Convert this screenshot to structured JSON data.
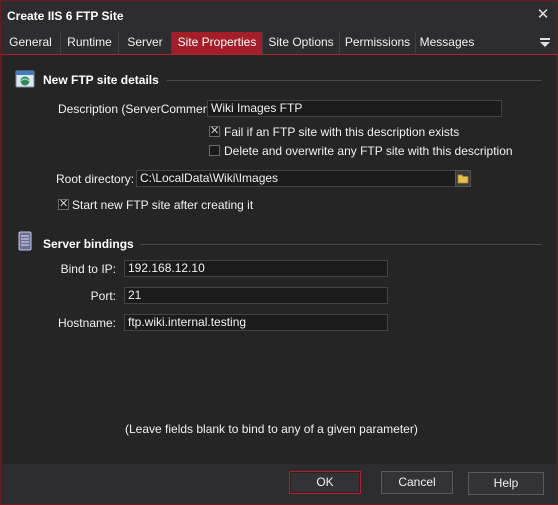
{
  "window": {
    "title": "Create IIS 6 FTP Site"
  },
  "tabs": [
    {
      "label": "General"
    },
    {
      "label": "Runtime"
    },
    {
      "label": "Server"
    },
    {
      "label": "Site Properties"
    },
    {
      "label": "Site Options"
    },
    {
      "label": "Permissions"
    },
    {
      "label": "Messages"
    }
  ],
  "active_tab": "Site Properties",
  "colors": {
    "accent": "#a31e28",
    "background": "#252526",
    "chrome": "#2d2d30"
  },
  "new_site": {
    "section_title": "New FTP site details",
    "description_label": "Description (ServerComment):",
    "description_value": "Wiki Images FTP",
    "fail_if_exists_label": "Fail if an FTP site with this description exists",
    "fail_if_exists_checked": true,
    "delete_overwrite_label": "Delete and overwrite any FTP site with this description",
    "delete_overwrite_checked": false,
    "root_dir_label": "Root directory:",
    "root_dir_value": "C:\\LocalData\\Wiki\\Images",
    "start_after_label": "Start new FTP site after creating it",
    "start_after_checked": true
  },
  "bindings": {
    "section_title": "Server bindings",
    "ip_label": "Bind to IP:",
    "ip_value": "192.168.12.10",
    "port_label": "Port:",
    "port_value": "21",
    "hostname_label": "Hostname:",
    "hostname_value": "ftp.wiki.internal.testing",
    "note": "(Leave fields blank to bind to any of a given parameter)"
  },
  "buttons": {
    "ok": "OK",
    "cancel": "Cancel",
    "help": "Help"
  },
  "icons": {
    "site_details": "ftp-site-icon",
    "bindings": "server-icon",
    "folder": "folder-icon",
    "close": "close-icon",
    "tab_menu": "menu-dropdown-icon"
  }
}
